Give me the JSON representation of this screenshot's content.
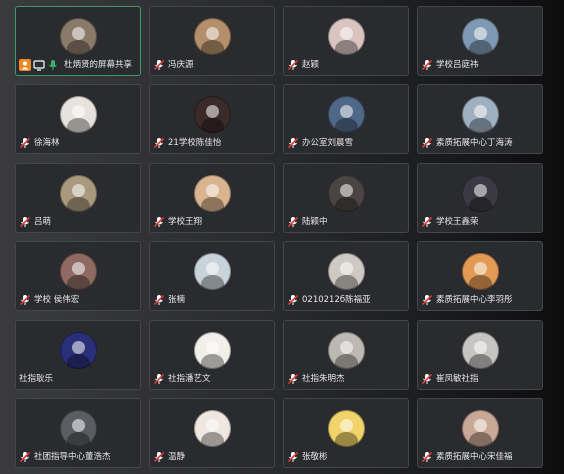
{
  "colors": {
    "tile_bg": "#2a2b2e",
    "tile_border": "#45464a",
    "active_border": "#3f9a6a",
    "name_text": "#e8e8e8",
    "mic_muted": "#d43b3b",
    "share_orange": "#f08a24",
    "share_green": "#36b36b"
  },
  "participants": [
    {
      "name": "杜炳贤的屏幕共享",
      "avatar_color": "#8a7a6a",
      "active": true,
      "icons": [
        "person-share-icon",
        "screen-share-icon",
        "microphone-icon"
      ]
    },
    {
      "name": "冯庆源",
      "avatar_color": "#b38f6a",
      "active": false,
      "icons": [
        "muted-mic-icon"
      ]
    },
    {
      "name": "赵颖",
      "avatar_color": "#d9c4c0",
      "active": false,
      "icons": [
        "muted-mic-icon"
      ]
    },
    {
      "name": "学校吕庭祎",
      "avatar_color": "#7f98b3",
      "active": false,
      "icons": [
        "muted-mic-icon"
      ]
    },
    {
      "name": "徐海林",
      "avatar_color": "#e8e2dc",
      "active": false,
      "icons": [
        "muted-mic-icon"
      ]
    },
    {
      "name": "21学校陈佳怡",
      "avatar_color": "#3a2a28",
      "active": false,
      "icons": [
        "muted-mic-icon"
      ]
    },
    {
      "name": "办公室刘晨雪",
      "avatar_color": "#4f6888",
      "active": false,
      "icons": [
        "muted-mic-icon"
      ]
    },
    {
      "name": "素质拓展中心丁海涛",
      "avatar_color": "#9fb0c2",
      "active": false,
      "icons": [
        "muted-mic-icon"
      ]
    },
    {
      "name": "吕萌",
      "avatar_color": "#a99a7e",
      "active": false,
      "icons": [
        "muted-mic-icon"
      ]
    },
    {
      "name": "学校王翔",
      "avatar_color": "#d9b48f",
      "active": false,
      "icons": [
        "muted-mic-icon"
      ]
    },
    {
      "name": "陆颖中",
      "avatar_color": "#4a4443",
      "active": false,
      "icons": [
        "muted-mic-icon"
      ]
    },
    {
      "name": "学校王鑫荣",
      "avatar_color": "#3b3a44",
      "active": false,
      "icons": [
        "muted-mic-icon"
      ]
    },
    {
      "name": "学校 侯伟宏",
      "avatar_color": "#8f6a62",
      "active": false,
      "icons": [
        "muted-mic-icon"
      ]
    },
    {
      "name": "张楠",
      "avatar_color": "#c9d3dc",
      "active": false,
      "icons": [
        "muted-mic-icon"
      ]
    },
    {
      "name": "0210212б陈福亚",
      "avatar_color": "#cfc9c3",
      "active": false,
      "icons": [
        "muted-mic-icon"
      ]
    },
    {
      "name": "素质拓展中心李羽彤",
      "avatar_color": "#e39a55",
      "active": false,
      "icons": [
        "muted-mic-icon"
      ]
    },
    {
      "name": "社指耿乐",
      "avatar_color": "#2a2f7a",
      "active": false,
      "icons": []
    },
    {
      "name": "社指潘艺文",
      "avatar_color": "#f2efe9",
      "active": false,
      "icons": [
        "muted-mic-icon"
      ]
    },
    {
      "name": "社指朱明杰",
      "avatar_color": "#bdb9b2",
      "active": false,
      "icons": [
        "muted-mic-icon"
      ]
    },
    {
      "name": "崔凤敏社指",
      "avatar_color": "#c7c5c3",
      "active": false,
      "icons": [
        "muted-mic-icon"
      ]
    },
    {
      "name": "社团指导中心董浩杰",
      "avatar_color": "#5a5d63",
      "active": false,
      "icons": [
        "muted-mic-icon"
      ]
    },
    {
      "name": "温静",
      "avatar_color": "#efe7e0",
      "active": false,
      "icons": [
        "muted-mic-icon"
      ]
    },
    {
      "name": "张敬彬",
      "avatar_color": "#f0d36a",
      "active": false,
      "icons": [
        "muted-mic-icon"
      ]
    },
    {
      "name": "素质拓展中心宋佳福",
      "avatar_color": "#c9a898",
      "active": false,
      "icons": [
        "muted-mic-icon"
      ]
    }
  ]
}
